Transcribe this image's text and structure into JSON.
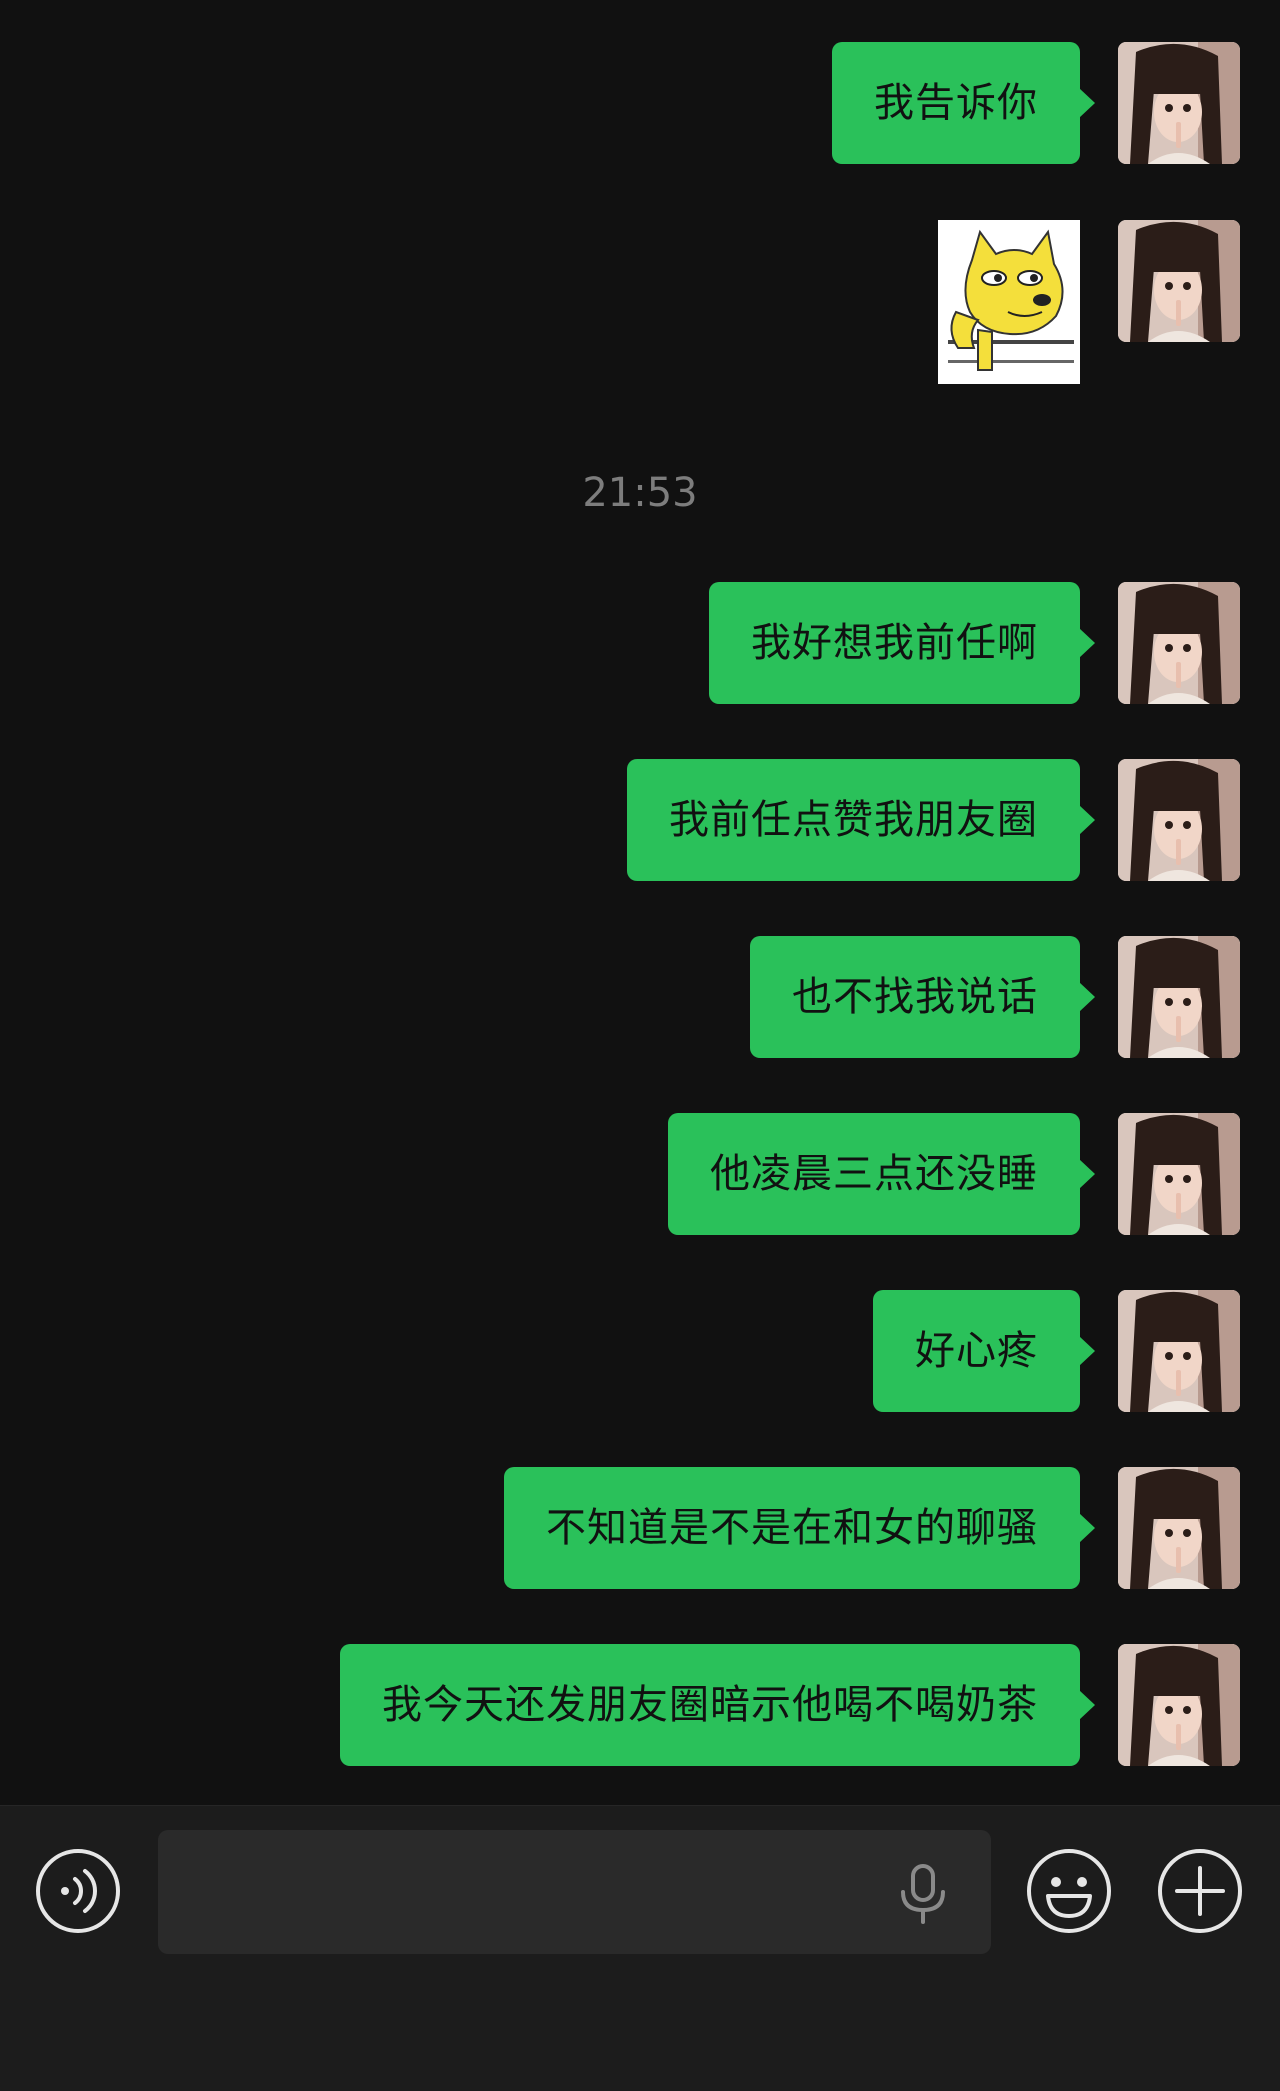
{
  "chat": {
    "timestamp": "21:53",
    "messages": [
      {
        "type": "text",
        "sender": "me",
        "text": "我告诉你"
      },
      {
        "type": "sticker",
        "sender": "me",
        "sticker": "doge-sticker"
      },
      {
        "type": "text",
        "sender": "me",
        "text": "我好想我前任啊"
      },
      {
        "type": "text",
        "sender": "me",
        "text": "我前任点赞我朋友圈"
      },
      {
        "type": "text",
        "sender": "me",
        "text": "也不找我说话"
      },
      {
        "type": "text",
        "sender": "me",
        "text": "他凌晨三点还没睡"
      },
      {
        "type": "text",
        "sender": "me",
        "text": "好心疼"
      },
      {
        "type": "text",
        "sender": "me",
        "text": "不知道是不是在和女的聊骚"
      },
      {
        "type": "text",
        "sender": "me",
        "text": "我今天还发朋友圈暗示他喝不喝奶茶"
      }
    ]
  },
  "toolbar": {
    "input_value": "",
    "icons": [
      "voice-mode-icon",
      "microphone-icon",
      "emoji-icon",
      "plus-icon"
    ]
  },
  "colors": {
    "background": "#111111",
    "bubble": "#2ac15a",
    "bubble_text": "#111111",
    "timestamp": "#7d7d7d",
    "toolbar": "#1c1c1c",
    "input": "#2a2a2a",
    "icon": "#e6e6e6"
  }
}
